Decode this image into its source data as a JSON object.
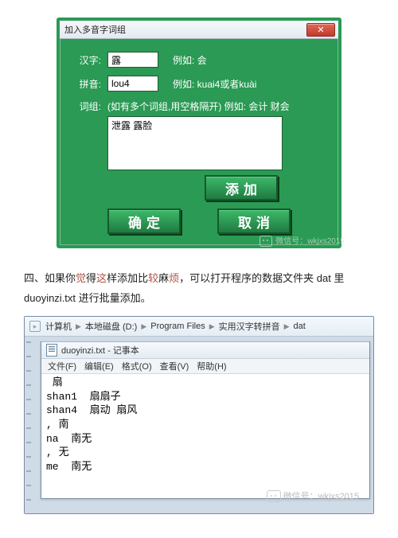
{
  "dialog": {
    "title": "加入多音字词组",
    "close": "✕",
    "hanzi_label": "汉字:",
    "hanzi_value": "露",
    "hanzi_hint": "例如: 会",
    "pinyin_label": "拼音:",
    "pinyin_value": "lou4",
    "pinyin_hint": "例如: kuai4或者kuài",
    "cizu_label": "词组:",
    "cizu_hint": "(如有多个词组,用空格隔开) 例如: 会计 财会",
    "cizu_value": "泄露 露脸",
    "btn_add": "添加",
    "btn_ok": "确定",
    "btn_cancel": "取消",
    "watermark": "微信号：wkjxs2015"
  },
  "paragraph": {
    "prefix": "四、如果你",
    "red1": "觉",
    "mid1": "得",
    "red2": "这",
    "mid2": "样添加比",
    "red3": "较",
    "mid3": "麻",
    "red4": "烦",
    "rest": "，可以打开程序的数据文件夹 dat 里 duoyinzi.txt 进行批量添加。"
  },
  "explorer": {
    "crumbs": [
      "计算机",
      "本地磁盘 (D:)",
      "Program Files",
      "实用汉字转拼音",
      "dat"
    ]
  },
  "notepad": {
    "title": "duoyinzi.txt - 记事本",
    "menu": [
      "文件(F)",
      "编辑(E)",
      "格式(O)",
      "查看(V)",
      "帮助(H)"
    ],
    "content": " 扇\nshan1  扇扇子\nshan4  扇动 扇风\n, 南\nna  南无\n, 无\nme  南无\n"
  },
  "watermark2": "微信号：wkjxs2015"
}
